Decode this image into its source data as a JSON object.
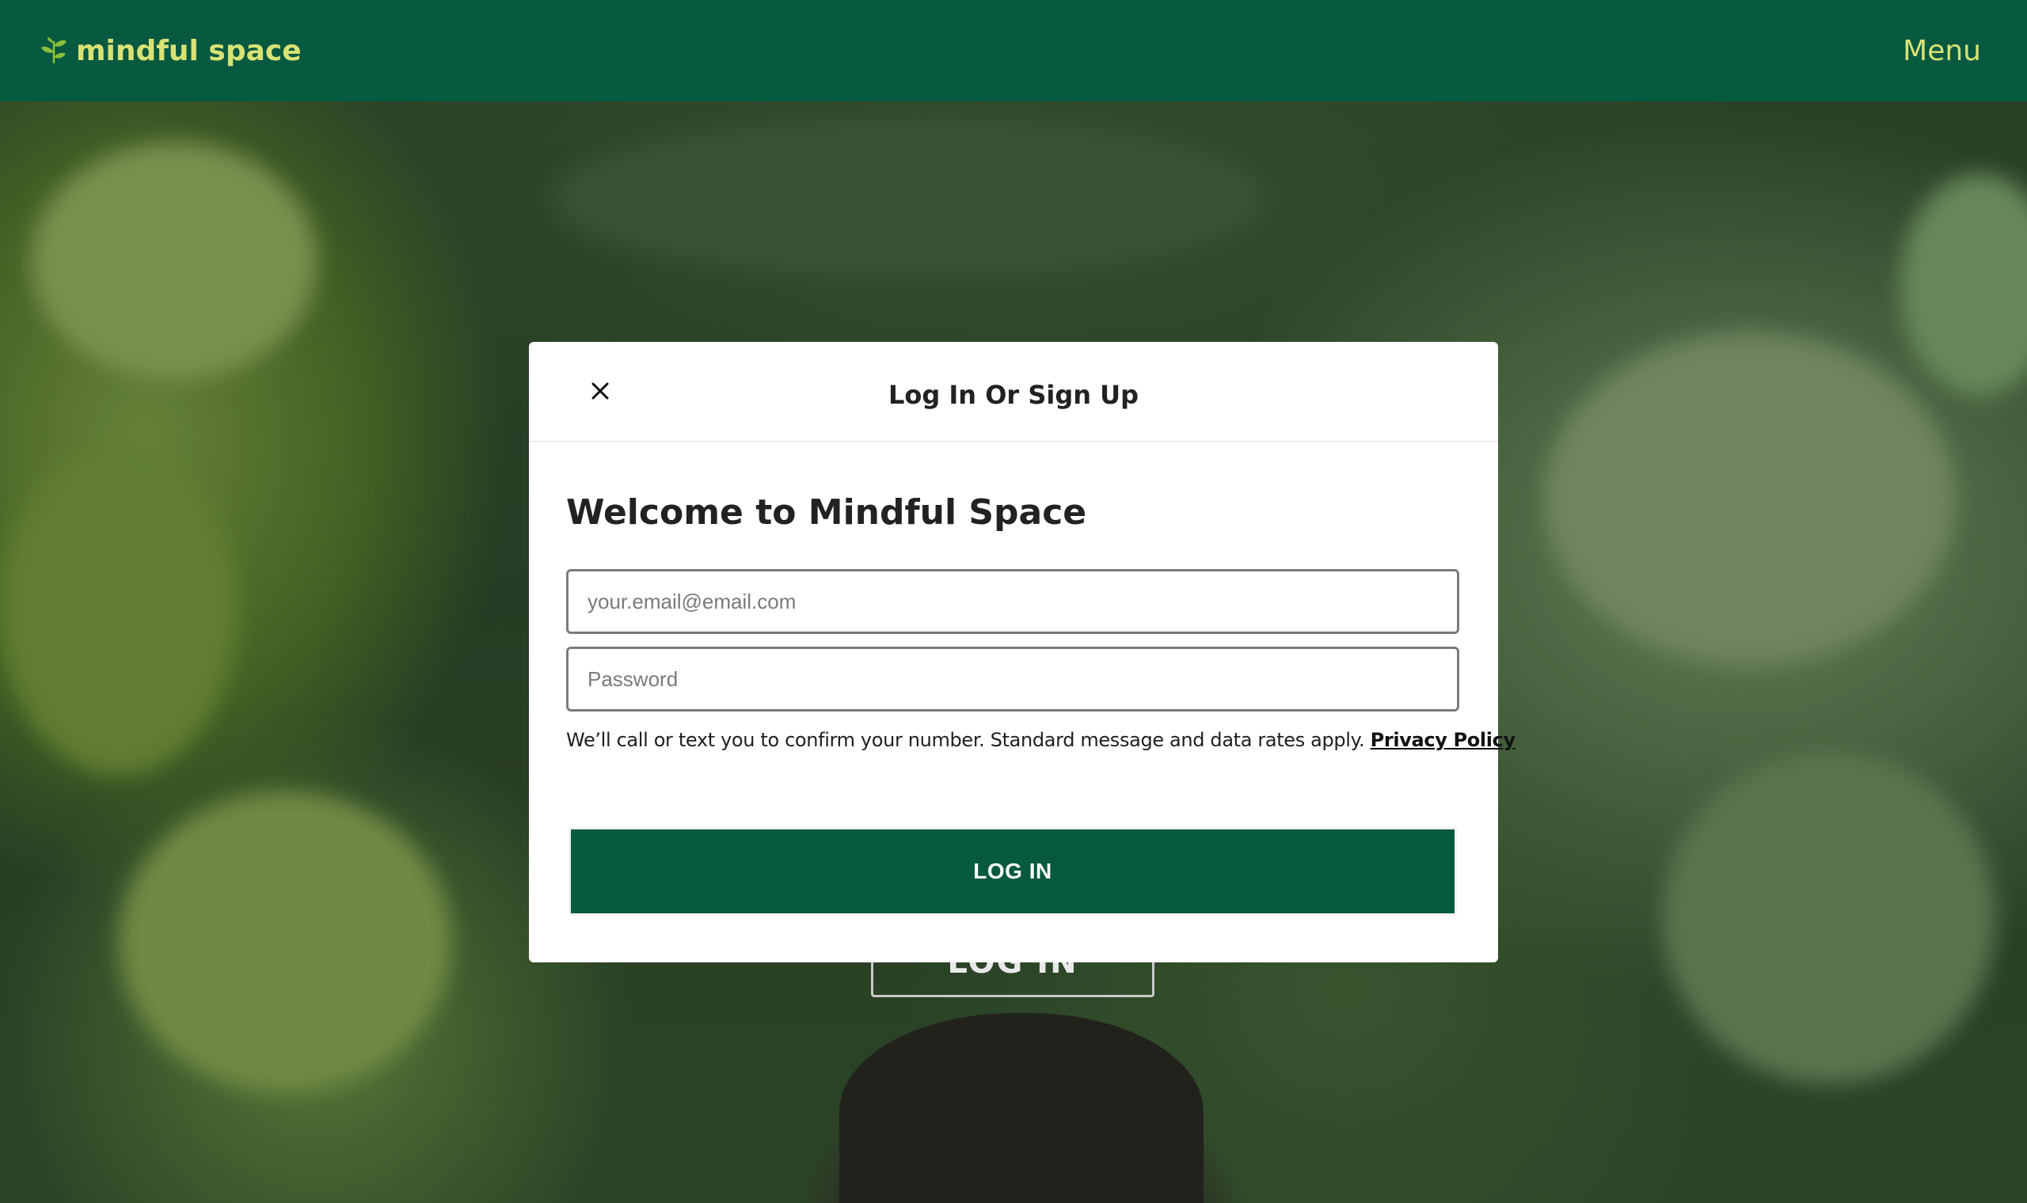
{
  "header": {
    "brand_name": "mindful space",
    "menu_label": "Menu",
    "brand_icon": "leaf-icon"
  },
  "background": {
    "login_button_label": "LOG IN"
  },
  "modal": {
    "title": "Log In Or Sign Up",
    "close_icon": "close-icon",
    "welcome_heading": "Welcome to Mindful Space",
    "email": {
      "value": "",
      "placeholder": "your.email@email.com"
    },
    "password": {
      "value": "",
      "placeholder": "Password"
    },
    "disclaimer": "We’ll call or text you to confirm your number. Standard message and data rates apply.",
    "privacy_link": "Privacy Policy",
    "login_label": "LOG IN"
  },
  "colors": {
    "brand_green": "#075940",
    "brand_text": "#d9e274",
    "modal_bg": "#ffffff"
  }
}
